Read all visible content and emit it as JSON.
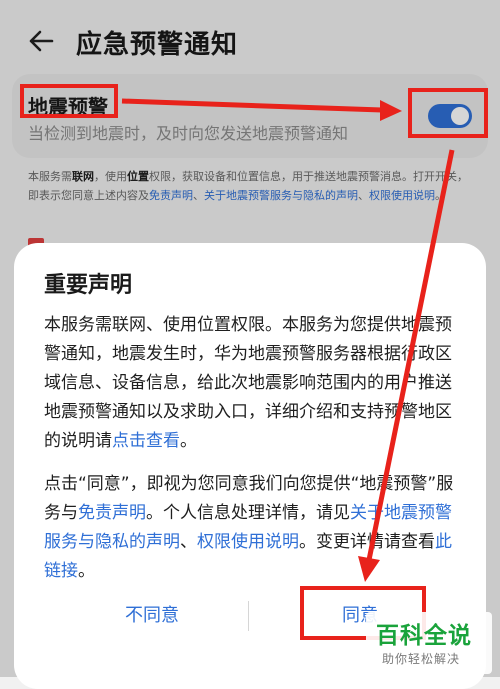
{
  "header": {
    "title": "应急预警通知",
    "back_icon": "arrow-left-icon"
  },
  "setting": {
    "title": "地震预警",
    "subtitle": "当检测到地震时，及时向您发送地震预警通知",
    "toggle_on": true,
    "toggle_color": "#2f6fd6"
  },
  "notice": {
    "t1": "本服务需",
    "b1": "联网",
    "t2": "，使用",
    "b2": "位置",
    "t3": "权限，获取设备和位置信息，用于推送地震预警消息。打开开关，即表示您同意上述内容及",
    "link1": "免责声明",
    "t4": "、",
    "link2": "关于地震预警服务与隐私的声明",
    "t5": "、",
    "link3": "权限使用说明",
    "t6": "。"
  },
  "dialog": {
    "title": "重要声明",
    "p1_text": "本服务需联网、使用位置权限。本服务为您提供地震预警通知，地震发生时，华为地震预警服务器根据行政区域信息、设备信息，给此次地震影响范围内的用户推送地震预警通知以及求助入口，详细介绍和支持预警地区 的说明请",
    "p1_link": "点击查看",
    "p1_end": "。",
    "p2_a": "点击“同意”，即视为您同意我们向您提供“地震预警”服务与",
    "p2_link1": "免责声明",
    "p2_b": "。个人信息处理详情，请见",
    "p2_link2": "关于地震预警服务与隐私的声明",
    "p2_c": "、",
    "p2_link3": "权限使用说明",
    "p2_d": "。变更详情请查看",
    "p2_link4": "此链接",
    "p2_end": "。",
    "disagree": "不同意",
    "agree": "同意"
  },
  "annotation_color": "#e8221b",
  "watermark": {
    "main": "百科全说",
    "sub": "助你轻松解决",
    "color": "#1aa33b"
  }
}
